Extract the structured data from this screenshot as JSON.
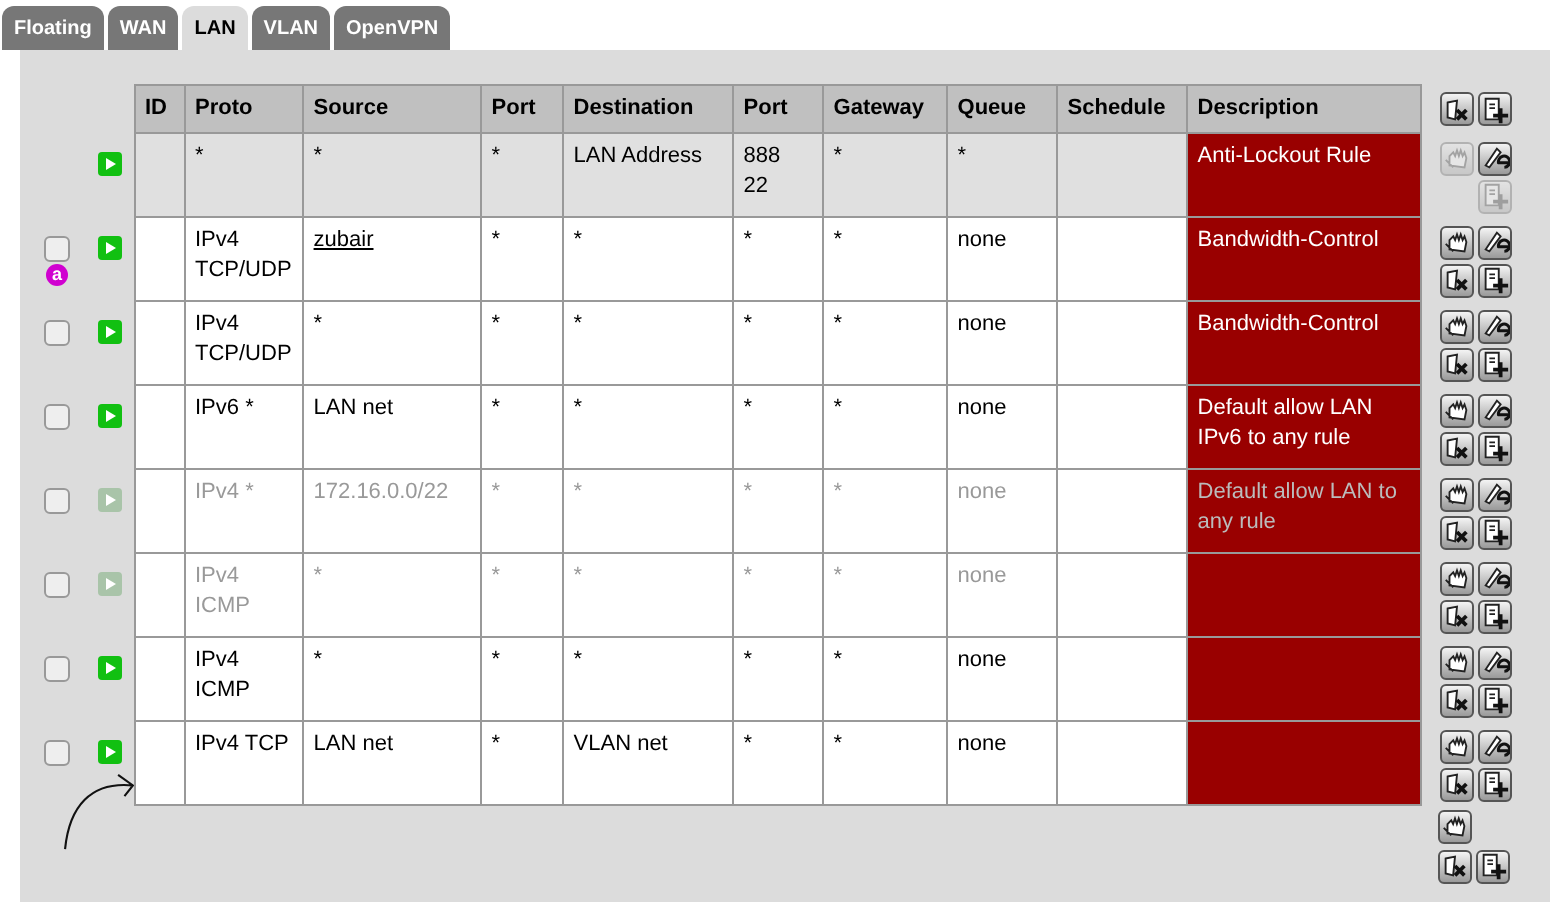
{
  "tabs": [
    {
      "label": "Floating",
      "selected": false
    },
    {
      "label": "WAN",
      "selected": false
    },
    {
      "label": "LAN",
      "selected": true
    },
    {
      "label": "VLAN",
      "selected": false
    },
    {
      "label": "OpenVPN",
      "selected": false
    }
  ],
  "table": {
    "columns": [
      "ID",
      "Proto",
      "Source",
      "Port",
      "Destination",
      "Port",
      "Gateway",
      "Queue",
      "Schedule",
      "Description"
    ],
    "rows": [
      {
        "kind": "locked",
        "enabled": true,
        "cells": [
          "",
          "*",
          "*",
          "*",
          "LAN Address",
          "888 22",
          "*",
          "*",
          "",
          "Anti-Lockout Rule"
        ]
      },
      {
        "kind": "rule",
        "checked": false,
        "badge": "a",
        "enabled": true,
        "source_link": true,
        "cells": [
          "",
          "IPv4 TCP/UDP",
          "zubair",
          "*",
          "*",
          "*",
          "*",
          "none",
          "",
          "Bandwidth-Control"
        ]
      },
      {
        "kind": "rule",
        "checked": false,
        "enabled": true,
        "source_link": false,
        "cells": [
          "",
          "IPv4 TCP/UDP",
          "*",
          "*",
          "*",
          "*",
          "*",
          "none",
          "",
          "Bandwidth-Control"
        ]
      },
      {
        "kind": "rule",
        "checked": false,
        "enabled": true,
        "source_link": false,
        "cells": [
          "",
          "IPv6 *",
          "LAN net",
          "*",
          "*",
          "*",
          "*",
          "none",
          "",
          "Default allow LAN IPv6 to any rule"
        ]
      },
      {
        "kind": "rule",
        "checked": false,
        "enabled": false,
        "source_link": false,
        "cells": [
          "",
          "IPv4 *",
          "172.16.0.0/22",
          "*",
          "*",
          "*",
          "*",
          "none",
          "",
          "Default allow LAN to any rule"
        ]
      },
      {
        "kind": "rule",
        "checked": false,
        "enabled": false,
        "source_link": false,
        "cells": [
          "",
          "IPv4 ICMP",
          "*",
          "*",
          "*",
          "*",
          "*",
          "none",
          "",
          ""
        ]
      },
      {
        "kind": "rule",
        "checked": false,
        "enabled": true,
        "source_link": false,
        "cells": [
          "",
          "IPv4 ICMP",
          "*",
          "*",
          "*",
          "*",
          "*",
          "none",
          "",
          ""
        ]
      },
      {
        "kind": "rule",
        "checked": false,
        "enabled": true,
        "source_link": false,
        "cells": [
          "",
          "IPv4 TCP",
          "LAN net",
          "*",
          "VLAN net",
          "*",
          "*",
          "none",
          "",
          ""
        ]
      }
    ]
  }
}
